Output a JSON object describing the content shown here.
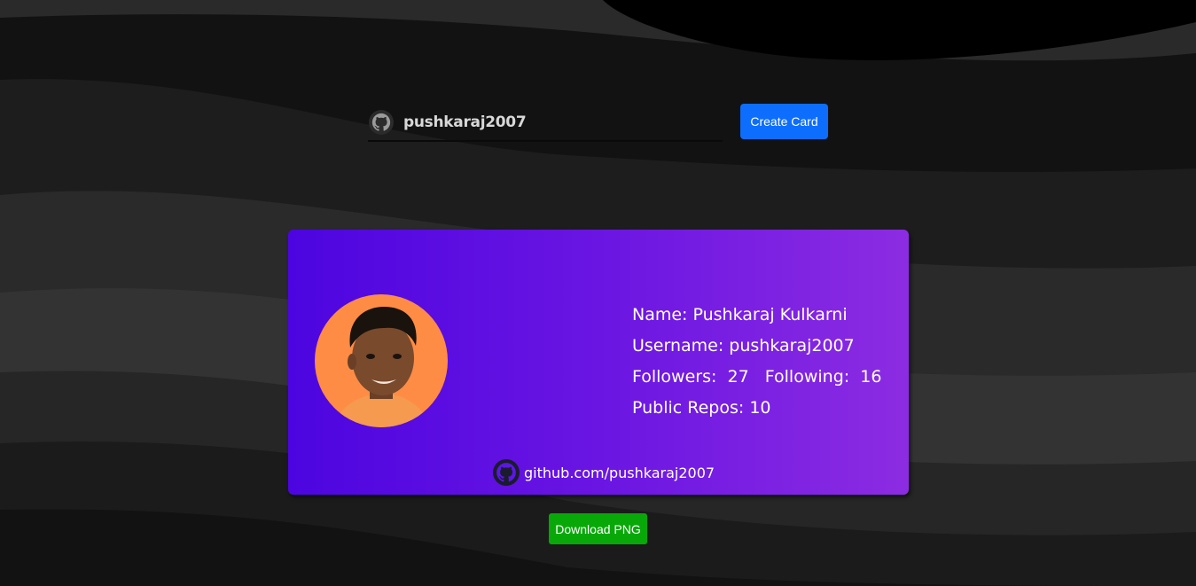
{
  "search": {
    "value": "pushkaraj2007",
    "icon": "github-icon"
  },
  "create_button": {
    "label": "Create Card",
    "color": "#0d6efd"
  },
  "card": {
    "gradient_start": "#4c05e0",
    "gradient_end": "#8c2ce2",
    "avatar_icon": "profile-photo",
    "name_label": "Name: Pushkaraj Kulkarni",
    "username_label": "Username: pushkaraj2007",
    "followers_row": "Followers:  27   Following:  16",
    "repos_label": "Public Repos: 10",
    "profile_link": "github.com/pushkaraj2007",
    "link_icon": "github-icon"
  },
  "download_button": {
    "label": "Download PNG",
    "color": "#08a808"
  }
}
